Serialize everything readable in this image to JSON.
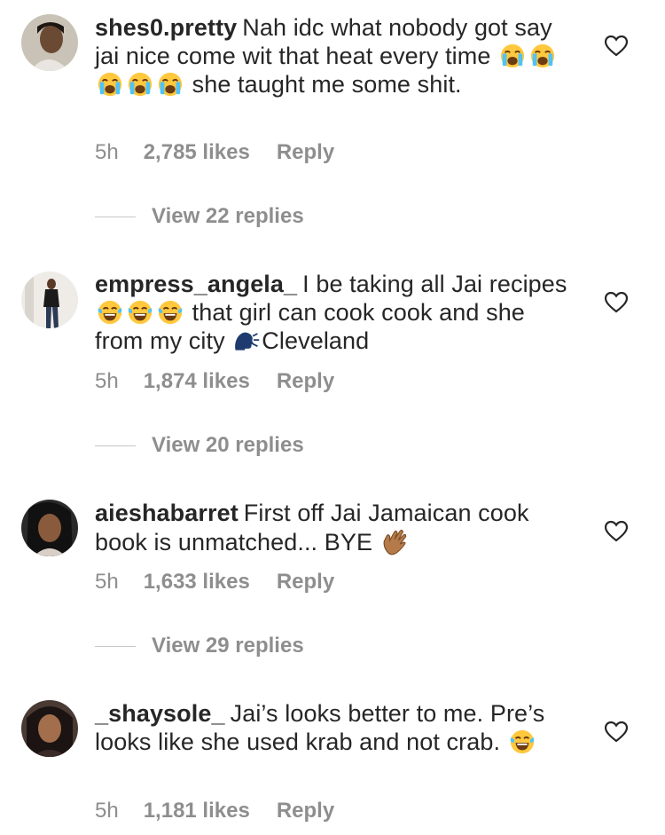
{
  "comments": [
    {
      "username": "shes0.pretty",
      "text_parts": [
        "Nah idc what nobody got say  jai nice come wit that heat every time ",
        " she taught me some shit."
      ],
      "time": "5h",
      "likes": "2,785 likes",
      "reply": "Reply",
      "view_replies": "View 22 replies"
    },
    {
      "username": "empress_angela_",
      "text_parts": [
        "I be taking all Jai recipes ",
        " that girl can cook cook and she from my city ",
        "Cleveland"
      ],
      "time": "5h",
      "likes": "1,874 likes",
      "reply": "Reply",
      "view_replies": "View 20 replies"
    },
    {
      "username": "aieshabarret",
      "text_parts": [
        "First off Jai Jamaican cook book is unmatched... BYE "
      ],
      "time": "5h",
      "likes": "1,633 likes",
      "reply": "Reply",
      "view_replies": "View 29 replies"
    },
    {
      "username": "_shaysole_",
      "text_parts": [
        "Jai’s looks better to me. Pre’s looks like she used krab and not crab. "
      ],
      "time": "5h",
      "likes": "1,181 likes",
      "reply": "Reply"
    }
  ],
  "icons": {
    "like": "heart-outline-icon",
    "loudly_crying": "loudly-crying-face-emoji",
    "tears_of_joy": "face-with-tears-of-joy-emoji",
    "speaking_head": "speaking-head-emoji",
    "waving_hand": "waving-hand-emoji"
  },
  "colors": {
    "text": "#262626",
    "secondary": "#8e8e8e",
    "divider": "#c7c7c7",
    "background": "#ffffff"
  }
}
